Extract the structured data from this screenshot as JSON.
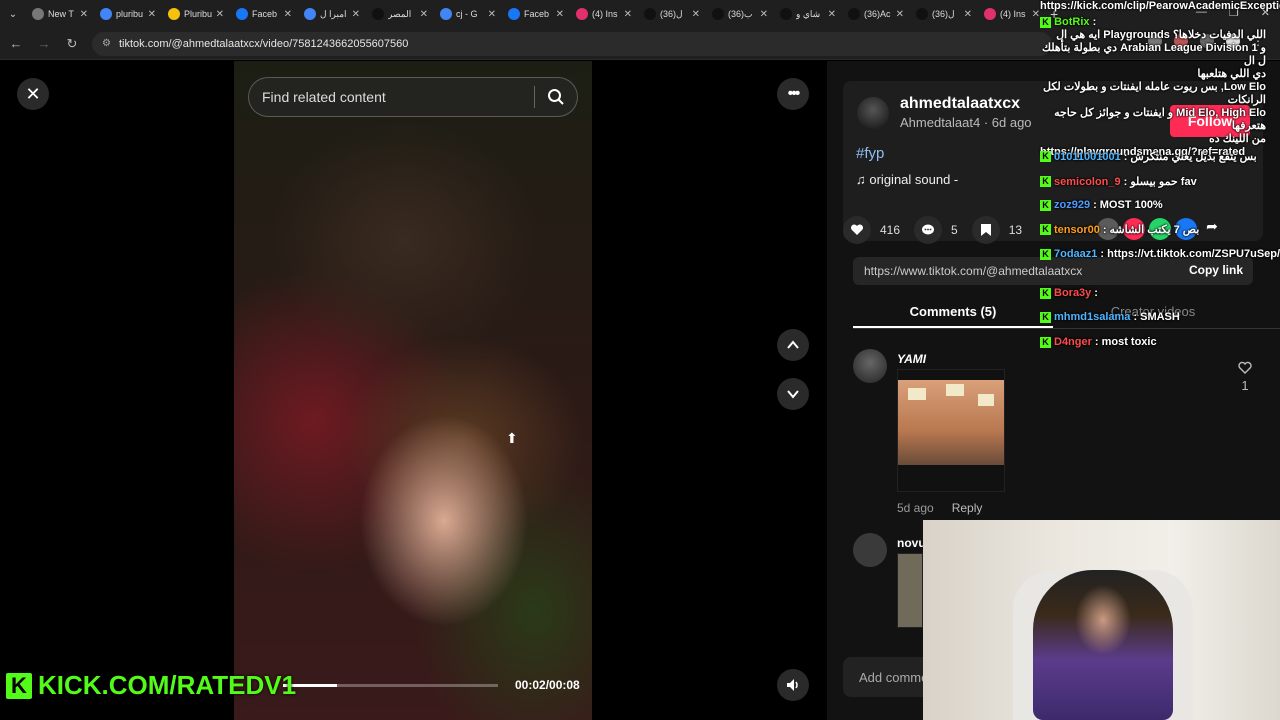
{
  "browser": {
    "tabs": [
      {
        "label": "New T",
        "icon": "chrome-icon",
        "color": "#777777"
      },
      {
        "label": "pluribu",
        "icon": "google-icon",
        "color": "#4285f4"
      },
      {
        "label": "Pluribu",
        "icon": "bookmark-icon",
        "color": "#f4c20d"
      },
      {
        "label": "Faceb",
        "icon": "facebook-icon",
        "color": "#1877f2"
      },
      {
        "label": "امبرا ل",
        "icon": "google-icon",
        "color": "#4285f4"
      },
      {
        "label": "المصر",
        "icon": "tiktok-icon",
        "color": "#111111"
      },
      {
        "label": "cj - G",
        "icon": "google-icon",
        "color": "#4285f4"
      },
      {
        "label": "Faceb",
        "icon": "facebook-icon",
        "color": "#1877f2"
      },
      {
        "label": "(4) Ins",
        "icon": "instagram-icon",
        "color": "#e1306c"
      },
      {
        "label": "(36)ل",
        "icon": "tiktok-icon",
        "color": "#111111"
      },
      {
        "label": "(36)ب",
        "icon": "tiktok-icon",
        "color": "#111111"
      },
      {
        "label": "شاي و",
        "icon": "tiktok-icon",
        "color": "#111111"
      },
      {
        "label": "(36)Ac",
        "icon": "tiktok-icon",
        "color": "#111111"
      },
      {
        "label": "(36)ل",
        "icon": "tiktok-icon",
        "color": "#111111"
      },
      {
        "label": "(4) Ins",
        "icon": "instagram-icon",
        "color": "#e1306c"
      }
    ],
    "url": "tiktok.com/@ahmedtalaatxcx/video/7581243662055607560"
  },
  "video": {
    "search_placeholder": "Find related content",
    "timecode": "00:02/00:08",
    "progress": 0.25
  },
  "author": {
    "username": "ahmedtalaatxcx",
    "nickname": "Ahmedtalaat4 · 6d ago",
    "follow_label": "Follow",
    "hashtag": "#fyp",
    "sound": "original sound -",
    "likes": "416",
    "comments": "5",
    "saves": "13",
    "link": "https://www.tiktok.com/@ahmedtalaatxcx",
    "copy_label": "Copy link"
  },
  "tabs": {
    "comments": "Comments (5)",
    "creator": "Creator videos"
  },
  "comments": [
    {
      "name": "YAMI",
      "time": "5d ago",
      "reply": "Reply",
      "likes": "1"
    },
    {
      "name": "novu",
      "time": "",
      "reply": "",
      "likes": ""
    }
  ],
  "add_comment_placeholder": "Add comme",
  "chat": {
    "pinned_url": "https://kick.com/clip/PearowAcademicExceptional",
    "bot_name": "BotRix",
    "bot_message_1": "اللي الدفيات دخلاها؟ Playgrounds ايه هي ال",
    "bot_message_2": "و Arabian League Division 1 دي بطولة بتأهلك ل ال",
    "bot_message_3": "دي اللي هتلعبها",
    "bot_message_4": "Low Elo, بس ريوت عامله ايفنتات و بطولات لكل الرانكات",
    "bot_message_5": "Mid Elo, High Elo و ايفنتات و جوائز كل حاجه هتعرفها",
    "bot_message_6": "من اللينك ده",
    "bot_link": "https://playgroundsmena.gg/?ref=rated",
    "messages": [
      {
        "user": "01011001001",
        "text": "بس يتقع بديل يعني منتكرش",
        "color": "#4fb6ff"
      },
      {
        "user": "semicolon_9",
        "text": "حمو بيسلو fav",
        "color": "#ff4b4b"
      },
      {
        "user": "zoz929",
        "text": "MOST 100%",
        "color": "#4f9bff"
      },
      {
        "user": "tensor00",
        "text": "بص 7 يكتب الشاشه",
        "color": "#ff9f1a"
      },
      {
        "user": "7odaaz1",
        "text": "https://vt.tiktok.com/ZSPU7uSep/",
        "color": "#4fb6ff"
      },
      {
        "user": "Bora3y",
        "text": "",
        "color": "#ff4b4b"
      },
      {
        "user": "mhmd1salama",
        "text": "SMASH",
        "color": "#4fb6ff"
      },
      {
        "user": "D4nger",
        "text": "most toxic",
        "color": "#ff4b4b"
      }
    ]
  },
  "watermark": "KICK.COM/RATEDV1"
}
